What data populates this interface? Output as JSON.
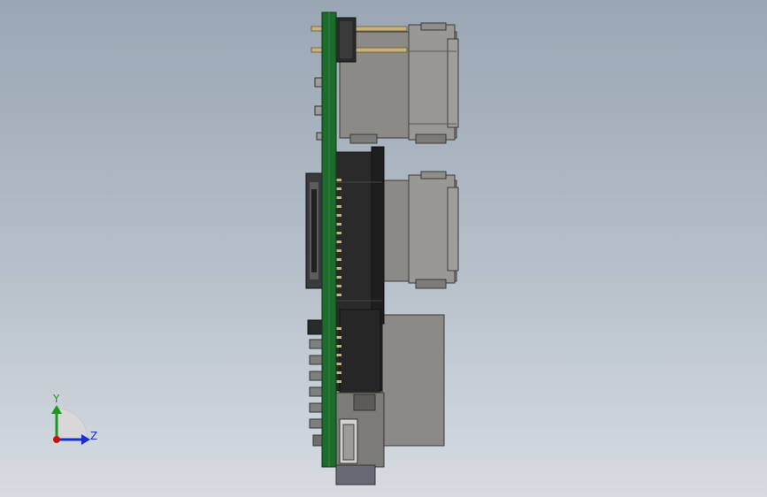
{
  "viewport": {
    "background_top": "#9aa6b4",
    "background_bottom": "#d7dce2"
  },
  "model": {
    "pcb_color": "#1e6b2e",
    "connector_color": "#2a2a2a",
    "metal_color": "#8c8a86",
    "gold_color": "#c9b27a"
  },
  "triad": {
    "y_label": "Y",
    "z_label": "Z",
    "y_color": "#1a9a1a",
    "z_color": "#1a2fd0",
    "x_color": "#cc1111"
  }
}
